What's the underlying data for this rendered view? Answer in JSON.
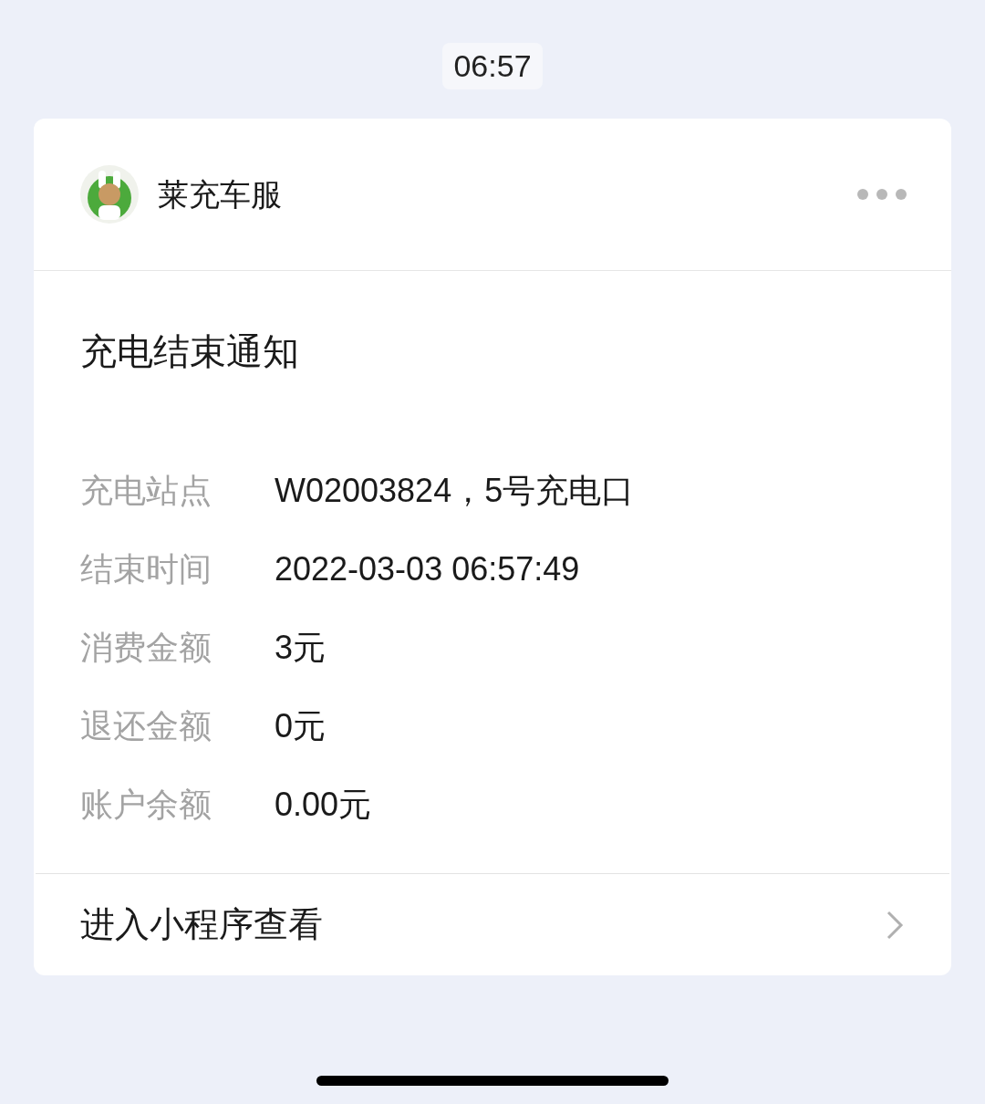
{
  "time": "06:57",
  "account": {
    "name": "莱充车服"
  },
  "notice": {
    "title": "充电结束通知",
    "fields": [
      {
        "label": "充电站点",
        "value": "W02003824，5号充电口"
      },
      {
        "label": "结束时间",
        "value": "2022-03-03 06:57:49"
      },
      {
        "label": "消费金额",
        "value": "3元"
      },
      {
        "label": "退还金额",
        "value": "0元"
      },
      {
        "label": "账户余额",
        "value": "0.00元"
      }
    ]
  },
  "link": {
    "label": "进入小程序查看"
  }
}
